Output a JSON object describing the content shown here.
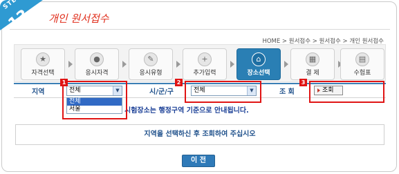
{
  "header": {
    "step_label": "STEP",
    "step_number": "13",
    "title": "개인 원서접수"
  },
  "breadcrumb": "HOME > 원서접수 > 원서접수 > 개인 원서접수",
  "steps": [
    {
      "label": "자격선택",
      "icon": "certificate-icon"
    },
    {
      "label": "응시자격",
      "icon": "person-icon"
    },
    {
      "label": "응시유형",
      "icon": "document-edit-icon"
    },
    {
      "label": "추가입력",
      "icon": "add-input-icon"
    },
    {
      "label": "장소선택",
      "icon": "building-icon",
      "active": true
    },
    {
      "label": "결  제",
      "icon": "calculator-icon"
    },
    {
      "label": "수험표",
      "icon": "ticket-icon"
    }
  ],
  "search": {
    "region_label": "지역",
    "region_value": "전체",
    "region_options": [
      "전체",
      "서울"
    ],
    "district_label": "시/군/구",
    "district_value": "전체",
    "query_label": "조 회",
    "query_button": "조회"
  },
  "markers": [
    "1",
    "2",
    "3"
  ],
  "notice": "시험장소는 행정구역 기준으로 안내됩니다.",
  "info_message": "지역을 선택하신 후 조회하여 주십시오",
  "prev_button": "이 전",
  "colors": {
    "accent_blue": "#2a7fb4",
    "highlight_red": "#e01414",
    "title_red": "#e0301e"
  }
}
